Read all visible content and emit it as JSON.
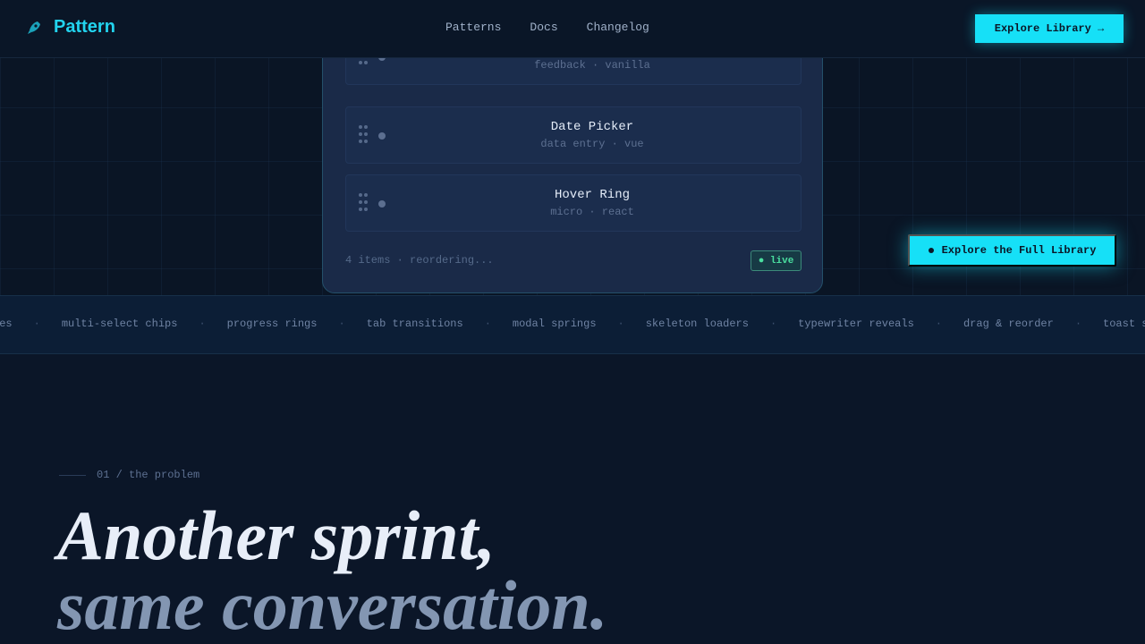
{
  "brand": {
    "name": "Pattern",
    "accent": "#22d3ee"
  },
  "nav": {
    "links": [
      "Patterns",
      "Docs",
      "Changelog"
    ],
    "cta_label": "Explore Library →"
  },
  "demo_card": {
    "items": [
      {
        "title": "",
        "meta": "feedback · vanilla"
      },
      {
        "title": "Date Picker",
        "meta": "data entry · vue"
      },
      {
        "title": "Hover Ring",
        "meta": "micro · react"
      }
    ],
    "footer": "4 items · reordering...",
    "badge": "● live"
  },
  "secondary_cta": {
    "label": "Explore the Full Library"
  },
  "marquee": {
    "items": [
      "ves",
      "multi-select chips",
      "progress rings",
      "tab transitions",
      "modal springs",
      "skeleton loaders",
      "typewriter reveals",
      "drag & reorder",
      "toast st"
    ],
    "separator": "·"
  },
  "problem": {
    "eyebrow": "01 / the problem",
    "headline_line1": "Another sprint,",
    "headline_line2": "same conversation."
  }
}
